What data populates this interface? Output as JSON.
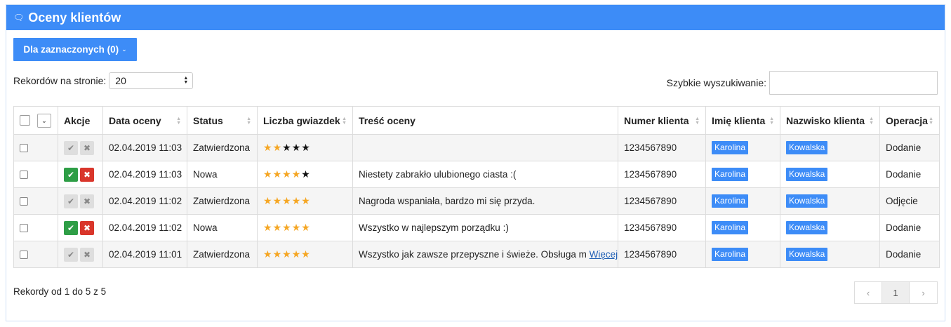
{
  "panel": {
    "title": "Oceny klientów",
    "icon": "comments-icon"
  },
  "toolbar": {
    "bulk_label": "Dla zaznaczonych (0)"
  },
  "per_page": {
    "label": "Rekordów na stronie:",
    "value": "20"
  },
  "search": {
    "label": "Szybkie wyszukiwanie:",
    "value": "",
    "placeholder": ""
  },
  "table": {
    "headers": {
      "actions": "Akcje",
      "date": "Data oceny",
      "status": "Status",
      "stars": "Liczba gwiazdek",
      "content": "Treść oceny",
      "client_number": "Numer klienta",
      "first_name": "Imię klienta",
      "last_name": "Nazwisko klienta",
      "operation": "Operacja"
    },
    "rows": [
      {
        "date": "02.04.2019 11:03",
        "status": "Zatwierdzona",
        "stars": 2,
        "content": "",
        "more": "",
        "client_number": "1234567890",
        "first_name": "Karolina",
        "last_name": "Kowalska",
        "operation": "Dodanie",
        "actions_active": false
      },
      {
        "date": "02.04.2019 11:03",
        "status": "Nowa",
        "stars": 4,
        "content": "Niestety zabrakło ulubionego ciasta :(",
        "more": "",
        "client_number": "1234567890",
        "first_name": "Karolina",
        "last_name": "Kowalska",
        "operation": "Dodanie",
        "actions_active": true
      },
      {
        "date": "02.04.2019 11:02",
        "status": "Zatwierdzona",
        "stars": 5,
        "content": "Nagroda wspaniała, bardzo mi się przyda.",
        "more": "",
        "client_number": "1234567890",
        "first_name": "Karolina",
        "last_name": "Kowalska",
        "operation": "Odjęcie",
        "actions_active": false
      },
      {
        "date": "02.04.2019 11:02",
        "status": "Nowa",
        "stars": 5,
        "content": "Wszystko w najlepszym porządku :)",
        "more": "",
        "client_number": "1234567890",
        "first_name": "Karolina",
        "last_name": "Kowalska",
        "operation": "Dodanie",
        "actions_active": true
      },
      {
        "date": "02.04.2019 11:01",
        "status": "Zatwierdzona",
        "stars": 5,
        "content": "Wszystko jak zawsze przepyszne i świeże. Obsługa m",
        "more": "Więcej",
        "client_number": "1234567890",
        "first_name": "Karolina",
        "last_name": "Kowalska",
        "operation": "Dodanie",
        "actions_active": false
      }
    ]
  },
  "footer": {
    "records_info": "Rekordy od 1 do 5 z 5",
    "pagination": {
      "prev": "‹",
      "current": "1",
      "next": "›"
    }
  },
  "colors": {
    "accent": "#3d8cf7",
    "approve": "#2e9e46",
    "reject": "#d9362b",
    "star": "#f5a623"
  }
}
